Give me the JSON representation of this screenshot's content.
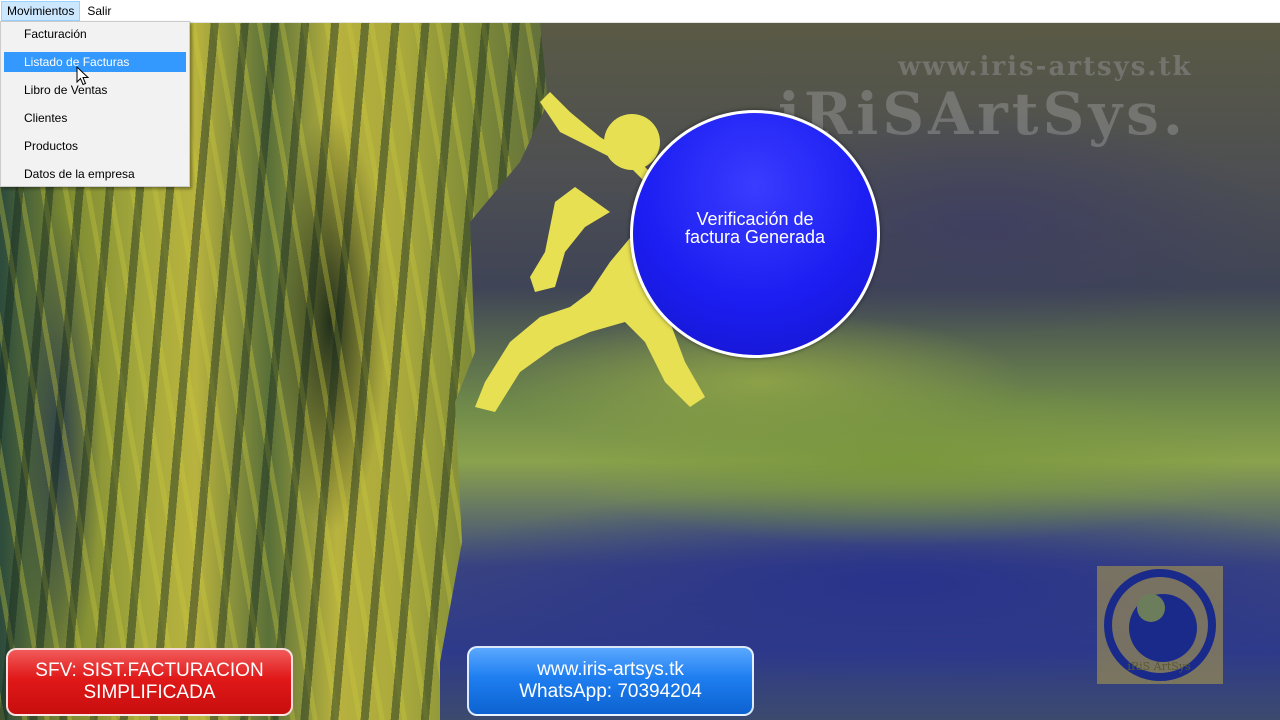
{
  "menubar": {
    "items": [
      {
        "label": "Movimientos",
        "active": true
      },
      {
        "label": "Salir",
        "active": false
      }
    ]
  },
  "dropdown": {
    "items": [
      {
        "label": "Facturación"
      },
      {
        "label": "Listado de Facturas",
        "highlighted": true
      },
      {
        "label": "Libro de Ventas"
      },
      {
        "label": "Clientes"
      },
      {
        "label": "Productos"
      },
      {
        "label": "Datos de la empresa"
      }
    ]
  },
  "watermark": {
    "url": "www.iris-artsys.tk",
    "brand": "iRiSArtSys."
  },
  "bubble": {
    "line1": "Verificación de",
    "line2": "factura Generada"
  },
  "badge_left": {
    "line1": "SFV: SIST.FACTURACION",
    "line2": "SIMPLIFICADA"
  },
  "badge_right": {
    "line1": "www.iris-artsys.tk",
    "line2": "WhatsApp: 70394204"
  },
  "logo": {
    "icon": "iris-logo-icon",
    "text": "iRiS ArtSys"
  },
  "colors": {
    "menu_highlight": "#3399ff",
    "bubble_blue": "#1c1ef2",
    "badge_red": "#e01818",
    "badge_blue": "#1e7ef0"
  }
}
